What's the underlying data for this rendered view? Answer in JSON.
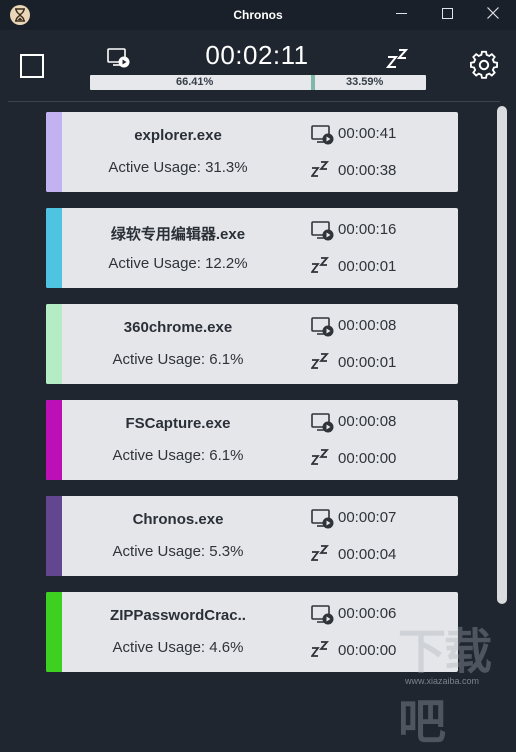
{
  "window": {
    "title": "Chronos"
  },
  "header": {
    "total_time": "00:02:11",
    "active_pct": "66.41%",
    "idle_pct": "33.59%",
    "active_fraction": 0.6641
  },
  "colors": {
    "background": "#1f2630",
    "card": "#e4e6e9"
  },
  "apps": [
    {
      "name": "explorer.exe",
      "usage": "Active Usage: 31.3%",
      "active_time": "00:00:41",
      "idle_time": "00:00:38",
      "color": "#c3b2f2"
    },
    {
      "name": "绿软专用编辑器.exe",
      "usage": "Active Usage: 12.2%",
      "active_time": "00:00:16",
      "idle_time": "00:00:01",
      "color": "#4fc4e2"
    },
    {
      "name": "360chrome.exe",
      "usage": "Active Usage: 6.1%",
      "active_time": "00:00:08",
      "idle_time": "00:00:01",
      "color": "#b4ecc6"
    },
    {
      "name": "FSCapture.exe",
      "usage": "Active Usage: 6.1%",
      "active_time": "00:00:08",
      "idle_time": "00:00:00",
      "color": "#bd0fb6"
    },
    {
      "name": "Chronos.exe",
      "usage": "Active Usage: 5.3%",
      "active_time": "00:00:07",
      "idle_time": "00:00:04",
      "color": "#62468f"
    },
    {
      "name": "ZIPPasswordCrac..",
      "usage": "Active Usage: 4.6%",
      "active_time": "00:00:06",
      "idle_time": "00:00:00",
      "color": "#3ed020"
    }
  ],
  "icons": {
    "app": "hourglass-icon",
    "minimize": "minimize-icon",
    "maximize": "maximize-icon",
    "close": "close-icon",
    "stop": "stop-icon",
    "active": "screen-play-icon",
    "idle": "sleep-zz-icon",
    "settings": "gear-icon"
  }
}
